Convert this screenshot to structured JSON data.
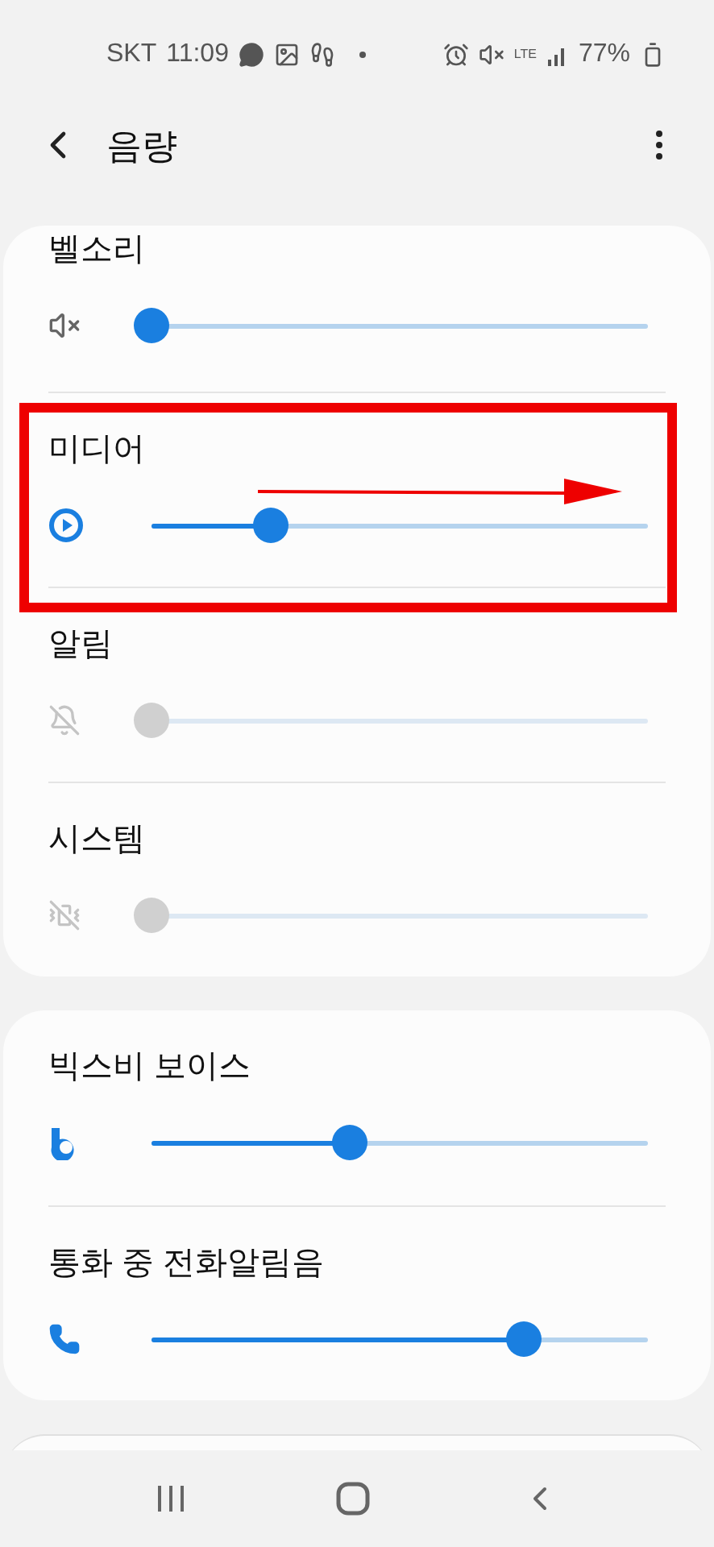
{
  "status_bar": {
    "carrier": "SKT",
    "time": "11:09",
    "network": "LTE",
    "battery": "77%"
  },
  "header": {
    "title": "음량"
  },
  "cards": [
    {
      "rows": [
        {
          "label": "벨소리",
          "kind": "muted-speaker",
          "disabled": false,
          "level": 0
        },
        {
          "label": "미디어",
          "kind": "play",
          "disabled": false,
          "level": 0.24
        },
        {
          "label": "알림",
          "kind": "muted-bell",
          "disabled": true,
          "level": 0
        },
        {
          "label": "시스템",
          "kind": "muted-vibrate",
          "disabled": true,
          "level": 0
        }
      ]
    },
    {
      "rows": [
        {
          "label": "빅스비 보이스",
          "kind": "bixby",
          "disabled": false,
          "level": 0.4
        },
        {
          "label": "통화 중 전화알림음",
          "kind": "phone",
          "disabled": false,
          "level": 0.75
        }
      ]
    }
  ]
}
